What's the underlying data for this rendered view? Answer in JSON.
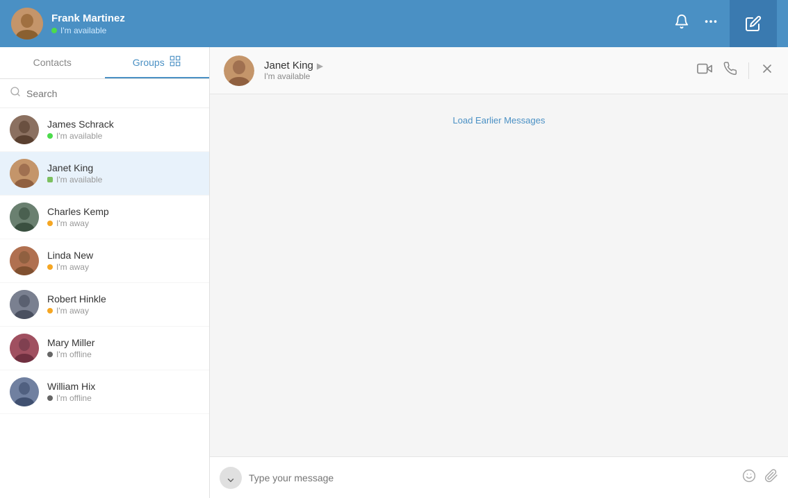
{
  "header": {
    "user_name": "Frank Martinez",
    "user_status": "I'm available",
    "status_type": "available",
    "notification_icon": "bell",
    "more_icon": "ellipsis",
    "compose_icon": "compose"
  },
  "sidebar": {
    "tabs": [
      {
        "id": "contacts",
        "label": "Contacts",
        "active": false
      },
      {
        "id": "groups",
        "label": "Groups",
        "active": true
      }
    ],
    "search_placeholder": "Search",
    "contacts": [
      {
        "id": 1,
        "name": "James Schrack",
        "status": "I'm available",
        "status_type": "available"
      },
      {
        "id": 2,
        "name": "Janet King",
        "status": "I'm available",
        "status_type": "mobile",
        "active": true
      },
      {
        "id": 3,
        "name": "Charles Kemp",
        "status": "I'm away",
        "status_type": "away"
      },
      {
        "id": 4,
        "name": "Linda New",
        "status": "I'm away",
        "status_type": "away"
      },
      {
        "id": 5,
        "name": "Robert Hinkle",
        "status": "I'm away",
        "status_type": "away"
      },
      {
        "id": 6,
        "name": "Mary Miller",
        "status": "I'm offline",
        "status_type": "offline"
      },
      {
        "id": 7,
        "name": "William Hix",
        "status": "I'm offline",
        "status_type": "offline"
      }
    ]
  },
  "chat": {
    "contact_name": "Janet King",
    "contact_status": "I'm available",
    "load_earlier_label": "Load Earlier Messages",
    "message_placeholder": "Type your message",
    "video_icon": "video",
    "phone_icon": "phone",
    "close_icon": "close",
    "emoji_icon": "emoji",
    "attach_icon": "paperclip",
    "scroll_down_icon": "chevron-down"
  }
}
